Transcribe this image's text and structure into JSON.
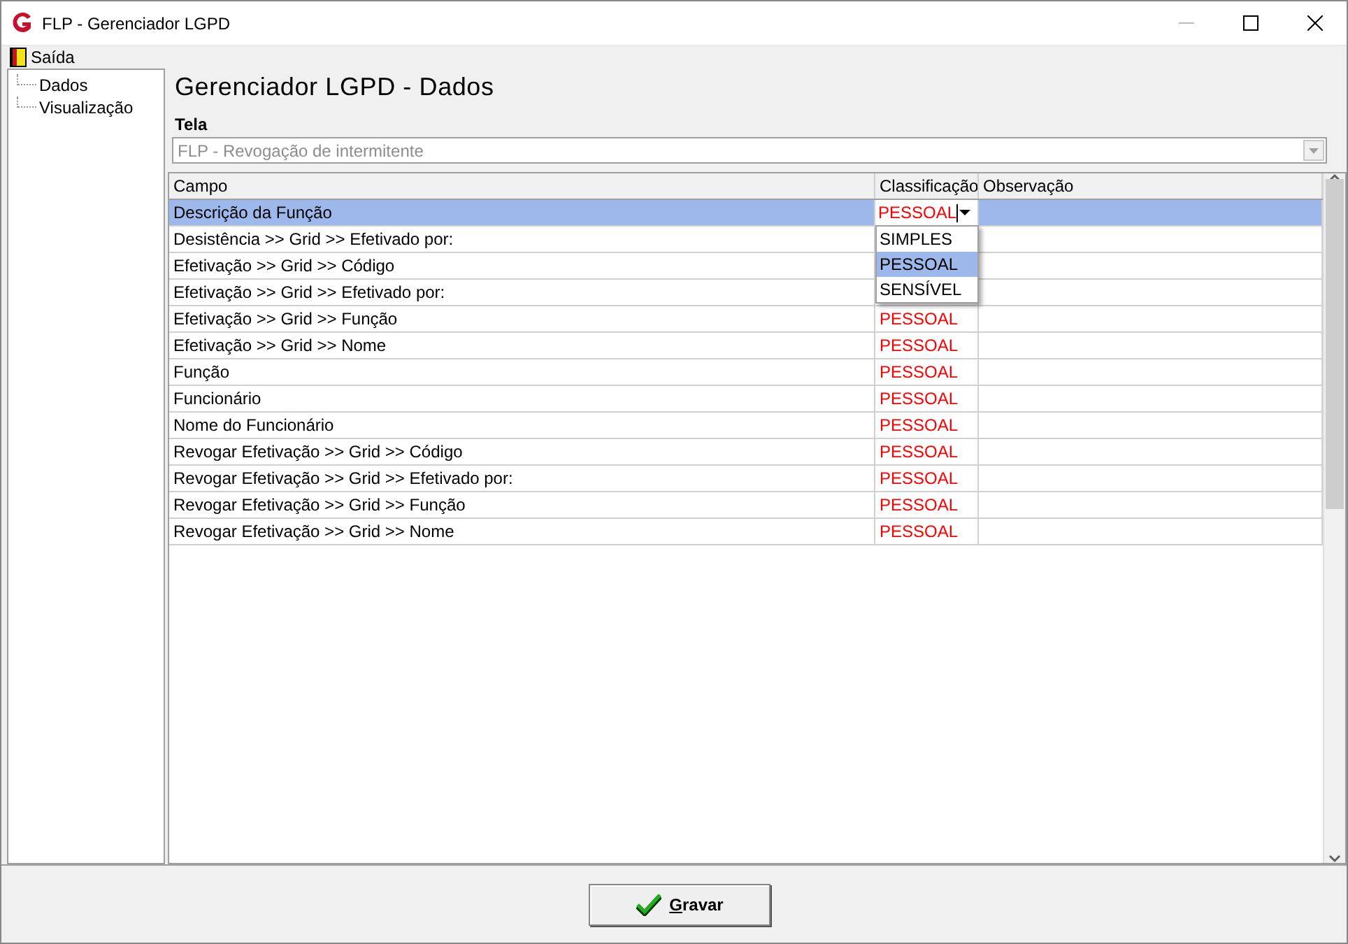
{
  "window": {
    "title": "FLP - Gerenciador LGPD"
  },
  "menu": [
    {
      "label": "Saída"
    }
  ],
  "tree": {
    "items": [
      {
        "label": "Dados"
      },
      {
        "label": "Visualização"
      }
    ]
  },
  "heading": "Gerenciador LGPD - Dados",
  "screen_field": {
    "label": "Tela",
    "value": "FLP - Revogação de intermitente",
    "disabled": true
  },
  "table": {
    "columns": [
      "Campo",
      "Classificação",
      "Observação"
    ],
    "rows": [
      {
        "campo": "Descrição da Função",
        "classificacao": "PESSOAL",
        "selected": true,
        "editing": true
      },
      {
        "campo": "Desistência >> Grid >> Efetivado por:",
        "selected": false,
        "editing": false
      },
      {
        "campo": "Efetivação >> Grid >> Código",
        "selected": false,
        "editing": false
      },
      {
        "campo": "Efetivação >> Grid >> Efetivado por:",
        "selected": false,
        "editing": false
      },
      {
        "campo": "Efetivação >> Grid >> Função",
        "classificacao": "PESSOAL",
        "selected": false,
        "editing": false
      },
      {
        "campo": "Efetivação >> Grid >> Nome",
        "classificacao": "PESSOAL",
        "selected": false,
        "editing": false
      },
      {
        "campo": "Função",
        "classificacao": "PESSOAL",
        "selected": false,
        "editing": false
      },
      {
        "campo": "Funcionário",
        "classificacao": "PESSOAL",
        "selected": false,
        "editing": false
      },
      {
        "campo": "Nome do Funcionário",
        "classificacao": "PESSOAL",
        "selected": false,
        "editing": false
      },
      {
        "campo": "Revogar Efetivação >> Grid >> Código",
        "classificacao": "PESSOAL",
        "selected": false,
        "editing": false
      },
      {
        "campo": "Revogar Efetivação >> Grid >> Efetivado por:",
        "classificacao": "PESSOAL",
        "selected": false,
        "editing": false
      },
      {
        "campo": "Revogar Efetivação >> Grid >> Função",
        "classificacao": "PESSOAL",
        "selected": false,
        "editing": false
      },
      {
        "campo": "Revogar Efetivação >> Grid >> Nome",
        "classificacao": "PESSOAL",
        "selected": false,
        "editing": false
      }
    ]
  },
  "dropdown": {
    "options": [
      {
        "label": "SIMPLES",
        "selected": false
      },
      {
        "label": "PESSOAL",
        "selected": true
      },
      {
        "label": "SENSÍVEL",
        "selected": false
      }
    ]
  },
  "buttons": [
    {
      "label": "Gravar"
    }
  ]
}
